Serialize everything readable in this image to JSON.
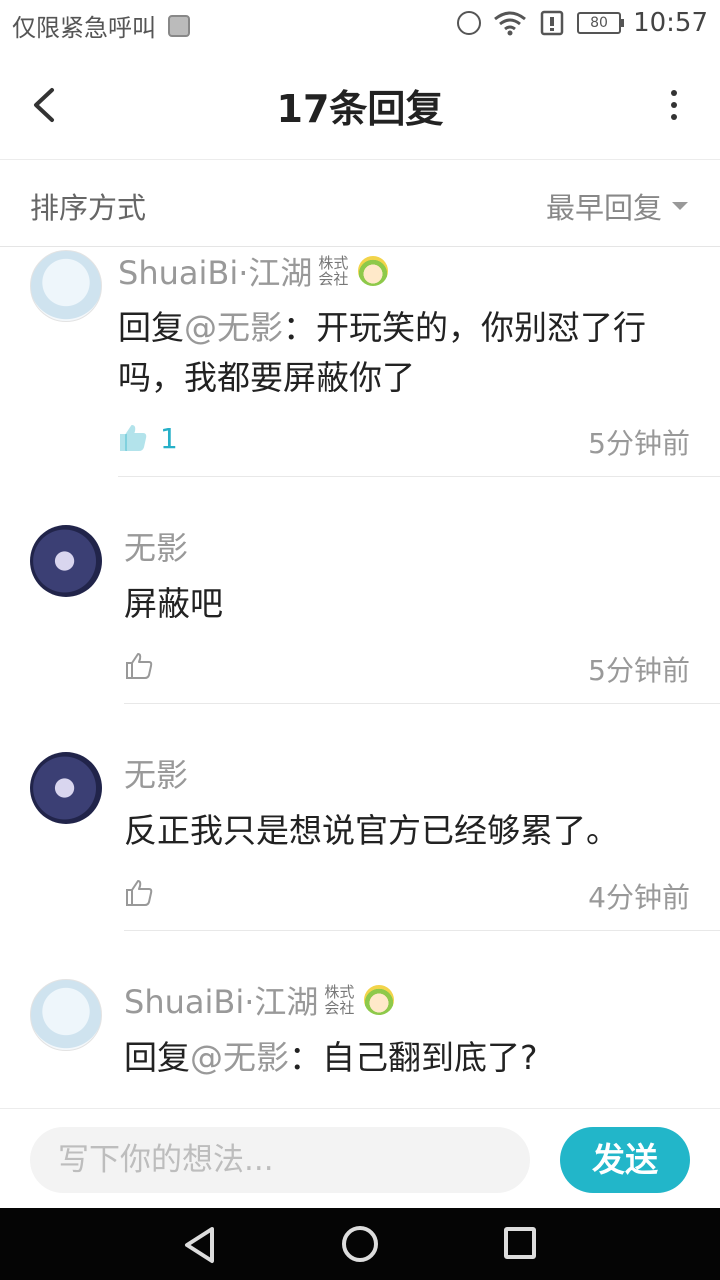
{
  "status_bar": {
    "carrier_text": "仅限紧急呼叫",
    "battery": "80",
    "time": "10:57"
  },
  "header": {
    "title": "17条回复"
  },
  "sort": {
    "label": "排序方式",
    "selected": "最早回复"
  },
  "comments": [
    {
      "username": "ShuaiBi·江湖",
      "tag_line1": "株式",
      "tag_line2": "会社",
      "reply_prefix": "回复",
      "mention": "@无影",
      "text": "：开玩笑的，你别怼了行",
      "text_line2": "吗，我都要屏蔽你了",
      "likes": "1",
      "time": "5分钟前"
    },
    {
      "username": "无影",
      "text": "屏蔽吧",
      "time": "5分钟前"
    },
    {
      "username": "无影",
      "text": "反正我只是想说官方已经够累了。",
      "time": "4分钟前"
    },
    {
      "username": "ShuaiBi·江湖",
      "tag_line1": "株式",
      "tag_line2": "会社",
      "reply_prefix": "回复",
      "mention": "@无影",
      "text": "：自己翻到底了?"
    }
  ],
  "input": {
    "placeholder": "写下你的想法...",
    "send_label": "发送"
  },
  "colors": {
    "accent": "#22b6c9",
    "like_active": "#27b0c8",
    "muted": "#999999"
  }
}
